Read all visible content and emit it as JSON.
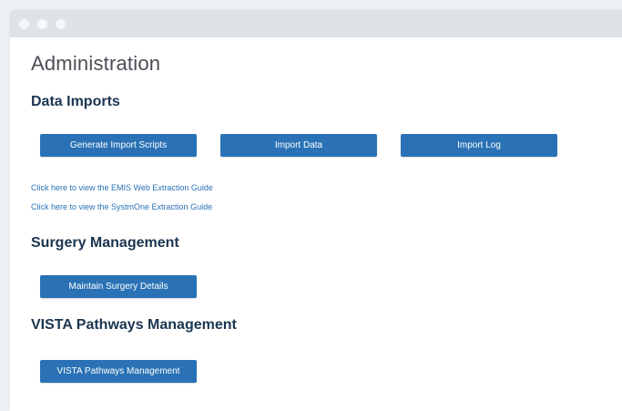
{
  "page": {
    "title": "Administration"
  },
  "sections": {
    "data_imports": {
      "title": "Data Imports",
      "buttons": {
        "generate": "Generate Import Scripts",
        "import": "Import Data",
        "log": "Import Log"
      },
      "links": {
        "emis": "Click here to view the EMIS Web Extraction Guide",
        "systmone": "Click here to view the SystmOne Extraction Guide"
      }
    },
    "surgery": {
      "title": "Surgery Management",
      "button": "Maintain Surgery Details"
    },
    "vista": {
      "title": "VISTA Pathways Management",
      "button": "VISTA Pathways Management"
    }
  },
  "colors": {
    "button_bg": "#2a72b5",
    "link": "#2a72b5",
    "heading": "#1b3550",
    "titlebar": "#dfe3e8"
  }
}
